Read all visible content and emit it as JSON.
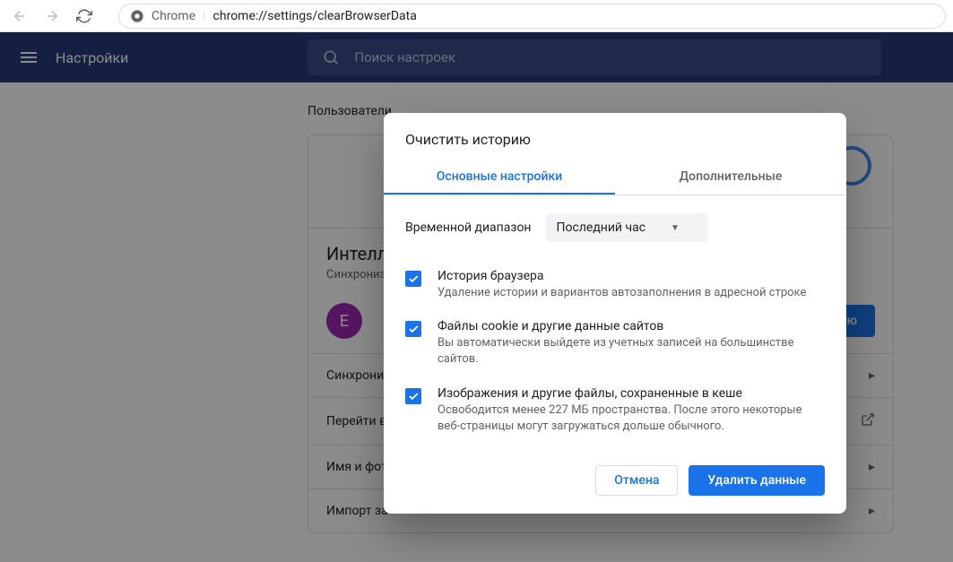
{
  "toolbar": {
    "chrome_label": "Chrome",
    "url": "chrome://settings/clearBrowserData"
  },
  "header": {
    "title": "Настройки",
    "search_placeholder": "Поиск настроек"
  },
  "section": {
    "title": "Пользователи"
  },
  "user": {
    "intellect_title": "Интеллектуальные функции",
    "intellect_sub": "Синхронизация",
    "initial": "E",
    "sync_btn": "изацию"
  },
  "rows": {
    "sync": "Синхрониз",
    "goto": "Перейти в",
    "name": "Имя и фот",
    "import": "Импорт за"
  },
  "dialog": {
    "title": "Очистить историю",
    "tab_basic": "Основные настройки",
    "tab_advanced": "Дополнительные",
    "time_label": "Временной диапазон",
    "time_value": "Последний час",
    "items": [
      {
        "title": "История браузера",
        "sub": "Удаление истории и вариантов автозаполнения в адресной строке"
      },
      {
        "title": "Файлы cookie и другие данные сайтов",
        "sub": "Вы автоматически выйдете из учетных записей на большинстве сайтов."
      },
      {
        "title": "Изображения и другие файлы, сохраненные в кеше",
        "sub": "Освободится менее 227 МБ пространства. После этого некоторые веб-страницы могут загружаться дольше обычного."
      }
    ],
    "cancel": "Отмена",
    "confirm": "Удалить данные"
  }
}
